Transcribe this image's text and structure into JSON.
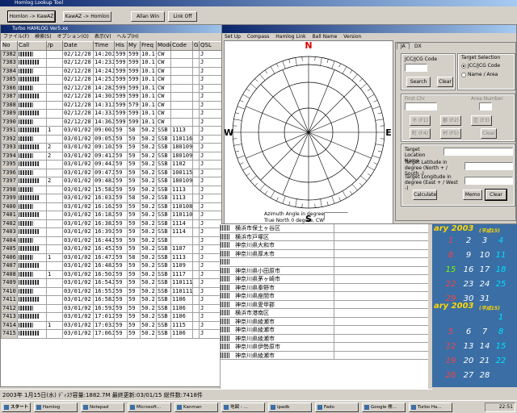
{
  "top_window": {
    "title": "Homlog Lookup Tool",
    "buttons": [
      "Homlon -> KawAZ",
      "KawAZ -> Homlon",
      "Allan Win",
      "Link Off"
    ]
  },
  "log_window": {
    "title": "Turbo HAMLOG Ver5.xx",
    "menu": [
      "ファイル(F)",
      "検索(S)",
      "オプション(O)",
      "表示(V)",
      "ヘルプ(H)"
    ],
    "columns": [
      "No",
      "Call",
      "/p",
      "Date",
      "Time",
      "His",
      "My",
      "Freq",
      "Mode",
      "Code",
      "G",
      "QSL"
    ],
    "rows": [
      [
        "7382",
        "",
        "",
        "02/12/28",
        "14:20J",
        "599",
        "599",
        "10.1",
        "CW",
        "",
        "",
        "J"
      ],
      [
        "7383",
        "",
        "",
        "02/12/28",
        "14:23J",
        "599",
        "599",
        "10.1",
        "CW",
        "",
        "",
        "J"
      ],
      [
        "7384",
        "",
        "",
        "02/12/28",
        "14:24J",
        "599",
        "599",
        "10.1",
        "CW",
        "",
        "",
        "J"
      ],
      [
        "7385",
        "",
        "",
        "02/12/28",
        "14:25J",
        "599",
        "599",
        "10.1",
        "CW",
        "",
        "",
        "J"
      ],
      [
        "7386",
        "",
        "",
        "02/12/28",
        "14:28J",
        "599",
        "599",
        "10.1",
        "CW",
        "",
        "",
        "J"
      ],
      [
        "7387",
        "",
        "",
        "02/12/28",
        "14:30J",
        "599",
        "599",
        "10.1",
        "CW",
        "",
        "",
        "J"
      ],
      [
        "7388",
        "",
        "",
        "02/12/28",
        "14:31J",
        "599",
        "579",
        "10.1",
        "CW",
        "",
        "",
        "J"
      ],
      [
        "7389",
        "",
        "",
        "02/12/28",
        "14:33J",
        "599",
        "599",
        "10.1",
        "CW",
        "",
        "",
        "J"
      ],
      [
        "7390",
        "",
        "",
        "02/12/28",
        "14:36J",
        "599",
        "599",
        "10.1",
        "CW",
        "",
        "",
        "J"
      ],
      [
        "7391",
        "",
        "1",
        "03/01/02",
        "09:00J",
        "59",
        "58",
        "50.2",
        "SSB",
        "1113",
        "",
        "J"
      ],
      [
        "7392",
        "",
        "",
        "03/01/02",
        "09:05J",
        "59",
        "59",
        "50.2",
        "SSB",
        "110116",
        "",
        "J"
      ],
      [
        "7393",
        "",
        "2",
        "03/01/02",
        "09:10J",
        "59",
        "59",
        "50.2",
        "SSB",
        "180109",
        "",
        "J"
      ],
      [
        "7394",
        "",
        "2",
        "03/01/02",
        "09:41J",
        "59",
        "59",
        "50.2",
        "SSB",
        "180109",
        "",
        "J"
      ],
      [
        "7395",
        "",
        "",
        "03/01/02",
        "09:44J",
        "59",
        "59",
        "50.2",
        "SSB",
        "1102",
        "",
        "J"
      ],
      [
        "7396",
        "",
        "",
        "03/01/02",
        "09:47J",
        "59",
        "59",
        "50.2",
        "SSB",
        "100115",
        "",
        "J"
      ],
      [
        "7397",
        "",
        "2",
        "03/01/02",
        "09:48J",
        "59",
        "59",
        "50.2",
        "SSB",
        "180109",
        "",
        "J"
      ],
      [
        "7398",
        "",
        "",
        "03/01/02",
        "15:58J",
        "59",
        "59",
        "50.2",
        "SSB",
        "1113",
        "",
        "J"
      ],
      [
        "7399",
        "",
        "",
        "03/01/02",
        "16:03J",
        "59",
        "58",
        "50.2",
        "SSB",
        "1113",
        "",
        "J"
      ],
      [
        "7400",
        "",
        "",
        "03/01/02",
        "16:16J",
        "59",
        "59",
        "50.2",
        "SSB",
        "110108",
        "",
        "J"
      ],
      [
        "7401",
        "",
        "",
        "03/01/02",
        "16:18J",
        "59",
        "59",
        "50.2",
        "SSB",
        "110110",
        "",
        "J"
      ],
      [
        "7402",
        "",
        "",
        "03/01/02",
        "16:38J",
        "59",
        "59",
        "50.2",
        "SSB",
        "1114",
        "",
        "J"
      ],
      [
        "7403",
        "",
        "",
        "03/01/02",
        "16:39J",
        "59",
        "59",
        "50.2",
        "SSB",
        "1114",
        "",
        "J"
      ],
      [
        "7404",
        "",
        "",
        "03/01/02",
        "16:44J",
        "59",
        "59",
        "50.2",
        "SSB",
        "",
        "",
        "J"
      ],
      [
        "7405",
        "",
        "",
        "03/01/02",
        "16:45J",
        "59",
        "59",
        "50.2",
        "SSB",
        "1107",
        "",
        "J"
      ],
      [
        "7406",
        "",
        "1",
        "03/01/02",
        "16:47J",
        "59",
        "58",
        "50.2",
        "SSB",
        "1113",
        "",
        "J"
      ],
      [
        "7407",
        "",
        "",
        "03/01/02",
        "16:48J",
        "59",
        "59",
        "50.2",
        "SSB",
        "1109",
        "",
        "J"
      ],
      [
        "7408",
        "",
        "1",
        "03/01/02",
        "16:50J",
        "59",
        "59",
        "50.2",
        "SSB",
        "1117",
        "",
        "J"
      ],
      [
        "7409",
        "",
        "",
        "03/01/02",
        "16:54J",
        "59",
        "59",
        "50.2",
        "SSB",
        "110111",
        "",
        "J"
      ],
      [
        "7410",
        "",
        "",
        "03/01/02",
        "16:55J",
        "59",
        "59",
        "50.2",
        "SSB",
        "110111",
        "",
        "J"
      ],
      [
        "7411",
        "",
        "",
        "03/01/02",
        "16:58J",
        "59",
        "59",
        "50.2",
        "SSB",
        "1106",
        "",
        "J"
      ],
      [
        "7412",
        "",
        "",
        "03/01/02",
        "16:59J",
        "59",
        "59",
        "50.2",
        "SSB",
        "1106",
        "",
        "J"
      ],
      [
        "7413",
        "",
        "",
        "03/01/02",
        "17:01J",
        "59",
        "59",
        "50.2",
        "SSB",
        "1106",
        "",
        "J"
      ],
      [
        "7414",
        "",
        "1",
        "03/01/02",
        "17:03J",
        "59",
        "59",
        "50.2",
        "SSB",
        "1115",
        "",
        "J"
      ],
      [
        "7415",
        "",
        "",
        "03/01/02",
        "17:06J",
        "59",
        "59",
        "50.2",
        "SSB",
        "1106",
        "",
        "J"
      ]
    ],
    "place_names": [
      "横浜市保土ヶ谷区",
      "横浜市戸塚区",
      "神奈川県大和市",
      "神奈川県厚木市",
      "",
      "神奈川県小田原市",
      "神奈川県茅ヶ崎市",
      "神奈川県秦野市",
      "神奈川県座間市",
      "神奈川県愛甲郡",
      "横浜市港南区",
      "神奈川県綾瀬市",
      "神奈川県綾瀬市",
      "神奈川県綾瀬市",
      "神奈川県伊勢原市",
      "神奈川県綾瀬市"
    ]
  },
  "status_bar": {
    "text": "2003年 1月15日(水)  ﾃﾞｨｽｸ容量:1882.7M  最終更新:03/01/15  総件数:7418件"
  },
  "compass_window": {
    "menu": [
      "Set Up",
      "Compass",
      "Hamlog Link",
      "Ball Name",
      "Version"
    ],
    "directions": {
      "n": "N",
      "e": "E",
      "s": "S",
      "w": "W"
    },
    "azimuth_label": "Azimuth Angle in degree",
    "azimuth_sub": "True North 0 degree, CW",
    "tabs": [
      "JA",
      "DX"
    ],
    "jcc_label": "JCC/JCG Code",
    "search_btn": "Search",
    "clear_btn": "Clear",
    "target_sel_label": "Target Selection",
    "radio_code": "JCC/JCG Code",
    "radio_name": "Name / Area",
    "first_chr_label": "First Chr",
    "area_num_label": "Area Number",
    "kana_btns": [
      "ホ (F1)",
      "郡 (F2)",
      "区 (F3)",
      "町 (F4)",
      "村 (F5)",
      "Clear"
    ],
    "target_loc_label": "Target Location Name",
    "lat_label": "Target Latitude in degree (North + / South -)",
    "lon_label": "Target Longitude in degree (East + / West -)",
    "calculate_btn": "Calculate",
    "memo_btn": "Memo",
    "clear2_btn": "Clear"
  },
  "calendar": {
    "month1": "ary 2003",
    "month1_sub": "(平成15)",
    "month1_days": [
      "1",
      "2",
      "3",
      "4",
      "8",
      "9",
      "10",
      "11",
      "15",
      "16",
      "17",
      "18",
      "22",
      "23",
      "24",
      "25",
      "29",
      "30",
      "31"
    ],
    "month2": "ary 2003",
    "month2_sub": "(平成15)",
    "month2_days": [
      "1",
      "5",
      "6",
      "7",
      "8",
      "12",
      "13",
      "14",
      "15",
      "19",
      "20",
      "21",
      "22",
      "26",
      "27",
      "28"
    ]
  },
  "taskbar": {
    "start": "スタート",
    "tasks": [
      "Hamlog",
      "Notepad",
      "Microsoft...",
      "Kanman",
      "地図 - ...",
      "ipadb",
      "Fado",
      "Google 検...",
      "Turbo Ha..."
    ],
    "clock": "22:51"
  }
}
